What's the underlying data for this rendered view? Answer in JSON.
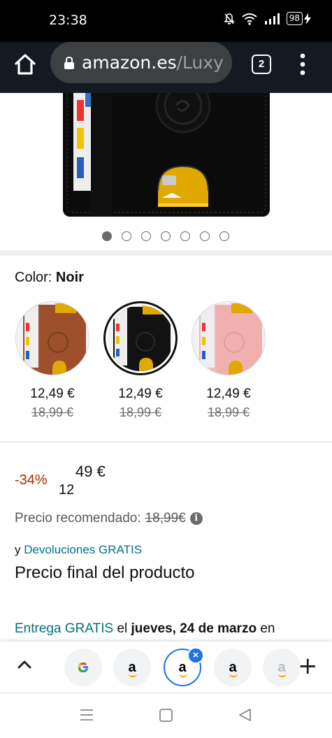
{
  "status_bar": {
    "time": "23:38",
    "battery_level": "98",
    "icons": [
      "mute-bell-icon",
      "wifi-icon",
      "signal-icon",
      "battery-icon",
      "charging-icon"
    ]
  },
  "browser": {
    "url_domain": "amazon.es",
    "url_path": "/Luxy",
    "tab_count": "2"
  },
  "carousel": {
    "total": 7,
    "active_index": 0
  },
  "color_selector": {
    "label": "Color:",
    "selected": "Noir",
    "options": [
      {
        "name": "brown",
        "price": "12,49 €",
        "old_price": "18,99 €",
        "color": "#a0522d"
      },
      {
        "name": "black",
        "price": "12,49 €",
        "old_price": "18,99 €",
        "color": "#111111"
      },
      {
        "name": "pink",
        "price": "12,49 €",
        "old_price": "18,99 €",
        "color": "#f2b8b8"
      }
    ]
  },
  "pricing": {
    "discount": "-34%",
    "price_whole": "12",
    "price_fraction": "49 €",
    "recommended_label": "Precio recomendado:",
    "recommended_value": "18,99€",
    "returns_prefix": "y",
    "returns_link": "Devoluciones GRATIS",
    "final_price_label": "Precio final del producto"
  },
  "delivery": {
    "link": "Entrega GRATIS",
    "text_1": "el",
    "date": "jueves, 24 de marzo",
    "text_2": "en"
  },
  "tab_strip": {
    "tabs": [
      "google",
      "amazon",
      "amazon",
      "amazon",
      "amazon"
    ],
    "active_tab": 2
  },
  "colors": {
    "link": "#007185",
    "discount": "#b12704",
    "accent": "#1a73e8",
    "toolbar": "#131a22"
  }
}
